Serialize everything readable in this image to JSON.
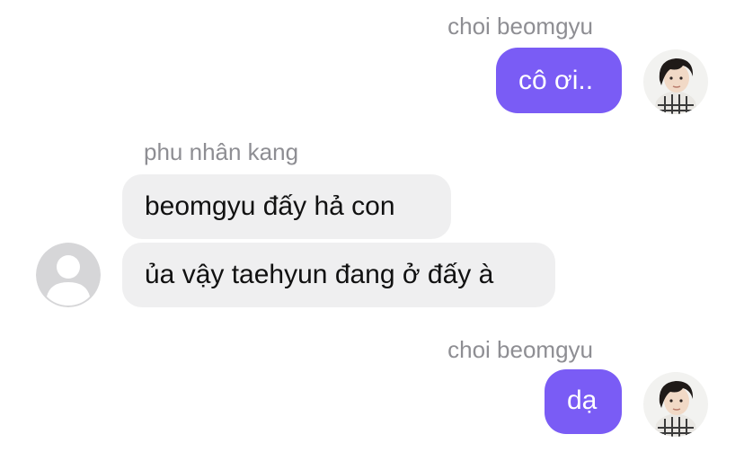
{
  "conversation": {
    "messages": [
      {
        "sender": "choi beomgyu",
        "direction": "outgoing",
        "text": "cô ơi.."
      },
      {
        "sender": "phu nhân kang",
        "direction": "incoming",
        "text": "beomgyu đấy hả con"
      },
      {
        "sender": "phu nhân kang",
        "direction": "incoming",
        "text": "ủa vậy taehyun đang ở đấy à"
      },
      {
        "sender": "choi beomgyu",
        "direction": "outgoing",
        "text": "dạ"
      }
    ]
  },
  "colors": {
    "outgoing_bubble": "#7a5cf5",
    "incoming_bubble": "#efeff0",
    "sender_name": "#8e8e93",
    "default_avatar": "#d6d6d8"
  },
  "icons": {
    "outgoing_avatar": "user-photo-avatar",
    "incoming_avatar": "default-person-icon"
  }
}
